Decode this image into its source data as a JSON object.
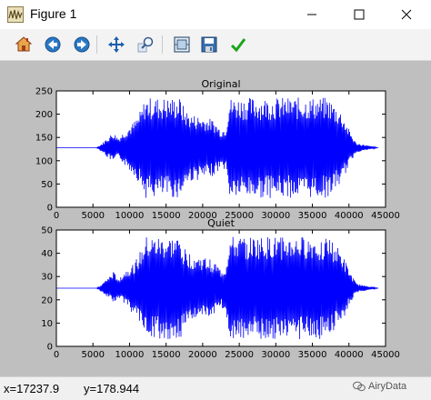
{
  "window": {
    "title": "Figure 1",
    "controls": [
      "minimize",
      "maximize",
      "close"
    ]
  },
  "toolbar": {
    "buttons": [
      {
        "name": "home",
        "icon": "home-icon"
      },
      {
        "name": "back",
        "icon": "back-arrow-icon"
      },
      {
        "name": "forward",
        "icon": "forward-arrow-icon"
      },
      {
        "name": "pan",
        "icon": "pan-arrows-icon"
      },
      {
        "name": "zoom",
        "icon": "zoom-icon"
      },
      {
        "name": "configure-subplots",
        "icon": "subplots-icon"
      },
      {
        "name": "save",
        "icon": "save-disk-icon"
      },
      {
        "name": "edit",
        "icon": "checkmark-icon"
      }
    ]
  },
  "status": {
    "x_readout": "x=17237.9",
    "y_readout": "y=178.944"
  },
  "watermark": "AiryData",
  "colors": {
    "signal": "#0000ff",
    "figure_background": "#bfbfbf",
    "axes_background": "#ffffff"
  },
  "chart_data": [
    {
      "type": "line",
      "title": "Original",
      "xlim": [
        0,
        45000
      ],
      "ylim": [
        0,
        250
      ],
      "xticks": [
        0,
        5000,
        10000,
        15000,
        20000,
        25000,
        30000,
        35000,
        40000,
        45000
      ],
      "yticks": [
        0,
        50,
        100,
        150,
        200,
        250
      ],
      "baseline": 128,
      "signal_extent": [
        0,
        44000
      ],
      "envelope": {
        "x": [
          0,
          5500,
          6300,
          7000,
          7800,
          8500,
          9500,
          10500,
          11200,
          11800,
          12100,
          14300,
          14700,
          17000,
          17500,
          18500,
          20000,
          21500,
          22500,
          23200,
          23600,
          29000,
          33000,
          36000,
          37200,
          38000,
          39000,
          40000,
          41000,
          44000
        ],
        "upper": [
          128,
          128,
          138,
          150,
          162,
          150,
          168,
          182,
          198,
          218,
          236,
          236,
          236,
          236,
          212,
          200,
          196,
          188,
          168,
          174,
          236,
          236,
          236,
          236,
          236,
          222,
          205,
          168,
          138,
          128
        ],
        "lower": [
          128,
          128,
          118,
          106,
          96,
          108,
          86,
          72,
          55,
          38,
          20,
          20,
          20,
          20,
          44,
          56,
          60,
          68,
          84,
          80,
          20,
          20,
          20,
          20,
          20,
          35,
          52,
          90,
          118,
          128
        ]
      }
    },
    {
      "type": "line",
      "title": "Quiet",
      "xlim": [
        0,
        45000
      ],
      "ylim": [
        0,
        50
      ],
      "xticks": [
        0,
        5000,
        10000,
        15000,
        20000,
        25000,
        30000,
        35000,
        40000,
        45000
      ],
      "yticks": [
        0,
        10,
        20,
        30,
        40,
        50
      ],
      "baseline": 25,
      "signal_extent": [
        0,
        44000
      ],
      "envelope": {
        "x": [
          0,
          5500,
          6300,
          7000,
          7800,
          8500,
          9500,
          10500,
          11200,
          11800,
          12100,
          14300,
          14700,
          17000,
          17500,
          18500,
          20000,
          21500,
          22500,
          23200,
          23600,
          29000,
          33000,
          36000,
          37200,
          38000,
          39000,
          40000,
          41000,
          44000
        ],
        "upper": [
          25,
          25,
          27,
          29.5,
          32,
          29.5,
          33,
          35.5,
          39,
          43,
          47,
          47,
          47,
          47,
          42,
          39.5,
          38.5,
          37,
          33,
          34.5,
          47,
          47,
          47,
          47,
          47,
          44,
          40.5,
          33,
          27,
          25
        ],
        "lower": [
          25,
          25,
          23,
          21,
          19,
          21,
          17,
          14,
          11,
          7.5,
          3,
          3,
          3,
          3,
          8.5,
          11,
          12,
          13.5,
          16.5,
          15.5,
          3,
          3,
          3,
          3,
          3,
          7,
          10,
          17.5,
          23,
          25
        ]
      }
    }
  ]
}
